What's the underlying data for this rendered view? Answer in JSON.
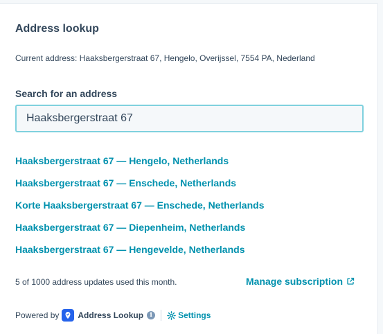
{
  "header": {
    "title": "Address lookup"
  },
  "current_address": "Current address: Haaksbergerstraat 67, Hengelo, Overijssel, 7554 PA, Nederland",
  "search": {
    "label": "Search for an address",
    "value": "Haaksbergerstraat 67"
  },
  "results": [
    "Haaksbergerstraat 67 — Hengelo, Netherlands",
    "Haaksbergerstraat 67 — Enschede, Netherlands",
    "Korte Haaksbergerstraat 67 — Enschede, Netherlands",
    "Haaksbergerstraat 67 — Diepenheim, Netherlands",
    "Haaksbergerstraat 67 — Hengevelde, Netherlands"
  ],
  "usage": {
    "text": "5 of 1000 address updates used this month.",
    "manage_label": "Manage subscription",
    "manage_icon": "external-link-icon"
  },
  "footer": {
    "powered_by": "Powered by",
    "brand_name": "Address Lookup",
    "brand_icon": "location-pin-icon",
    "info_glyph": "i",
    "settings_label": "Settings",
    "settings_icon": "gear-icon"
  },
  "colors": {
    "text": "#33475b",
    "link": "#0091ae",
    "input_border": "#7fd1de",
    "brand": "#2563eb"
  }
}
